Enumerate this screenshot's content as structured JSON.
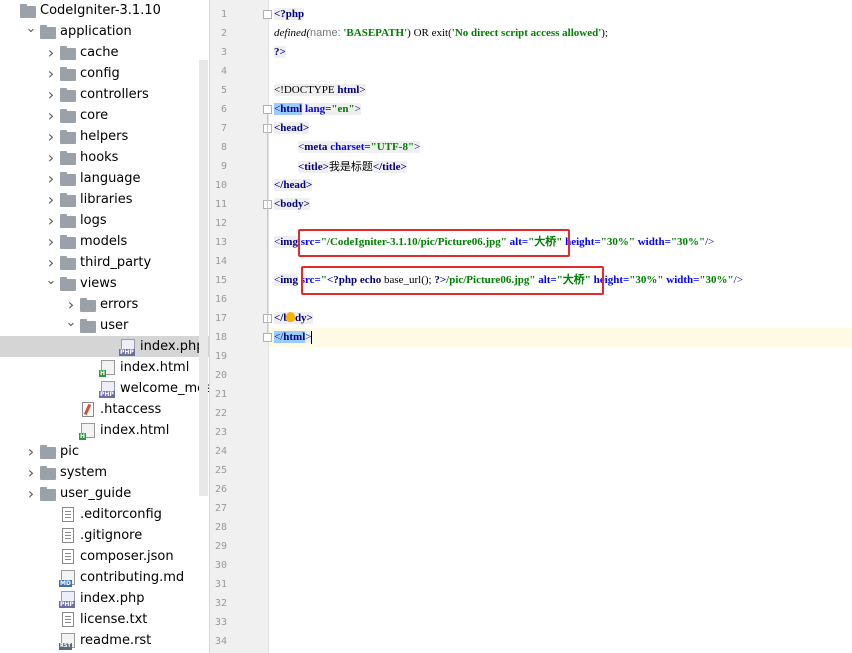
{
  "project_tree": {
    "items": [
      {
        "label": "CodeIgniter-3.1.10",
        "icon": "folder-icon",
        "depth": 0,
        "arrow": "none",
        "selected": false
      },
      {
        "label": "application",
        "icon": "folder-icon",
        "depth": 1,
        "arrow": "down",
        "selected": false
      },
      {
        "label": "cache",
        "icon": "folder-icon",
        "depth": 2,
        "arrow": "right",
        "selected": false
      },
      {
        "label": "config",
        "icon": "folder-icon",
        "depth": 2,
        "arrow": "right",
        "selected": false
      },
      {
        "label": "controllers",
        "icon": "folder-icon",
        "depth": 2,
        "arrow": "right",
        "selected": false
      },
      {
        "label": "core",
        "icon": "folder-icon",
        "depth": 2,
        "arrow": "right",
        "selected": false
      },
      {
        "label": "helpers",
        "icon": "folder-icon",
        "depth": 2,
        "arrow": "right",
        "selected": false
      },
      {
        "label": "hooks",
        "icon": "folder-icon",
        "depth": 2,
        "arrow": "right",
        "selected": false
      },
      {
        "label": "language",
        "icon": "folder-icon",
        "depth": 2,
        "arrow": "right",
        "selected": false
      },
      {
        "label": "libraries",
        "icon": "folder-icon",
        "depth": 2,
        "arrow": "right",
        "selected": false
      },
      {
        "label": "logs",
        "icon": "folder-icon",
        "depth": 2,
        "arrow": "right",
        "selected": false
      },
      {
        "label": "models",
        "icon": "folder-icon",
        "depth": 2,
        "arrow": "right",
        "selected": false
      },
      {
        "label": "third_party",
        "icon": "folder-icon",
        "depth": 2,
        "arrow": "right",
        "selected": false
      },
      {
        "label": "views",
        "icon": "folder-icon",
        "depth": 2,
        "arrow": "down",
        "selected": false
      },
      {
        "label": "errors",
        "icon": "folder-icon",
        "depth": 3,
        "arrow": "right",
        "selected": false
      },
      {
        "label": "user",
        "icon": "folder-icon",
        "depth": 3,
        "arrow": "down",
        "selected": false
      },
      {
        "label": "index.php",
        "icon": "php-icon",
        "depth": 5,
        "arrow": "none",
        "selected": true
      },
      {
        "label": "index.html",
        "icon": "html-icon",
        "depth": 4,
        "arrow": "none",
        "selected": false
      },
      {
        "label": "welcome_message.ph",
        "icon": "php-icon",
        "depth": 4,
        "arrow": "none",
        "selected": false
      },
      {
        "label": ".htaccess",
        "icon": "htaccess-icon",
        "depth": 3,
        "arrow": "none",
        "selected": false
      },
      {
        "label": "index.html",
        "icon": "html-icon",
        "depth": 3,
        "arrow": "none",
        "selected": false
      },
      {
        "label": "pic",
        "icon": "folder-icon",
        "depth": 1,
        "arrow": "right",
        "selected": false
      },
      {
        "label": "system",
        "icon": "folder-icon",
        "depth": 1,
        "arrow": "right",
        "selected": false
      },
      {
        "label": "user_guide",
        "icon": "folder-icon",
        "depth": 1,
        "arrow": "right",
        "selected": false
      },
      {
        "label": ".editorconfig",
        "icon": "file-icon",
        "depth": 2,
        "arrow": "none",
        "selected": false
      },
      {
        "label": ".gitignore",
        "icon": "file-icon",
        "depth": 2,
        "arrow": "none",
        "selected": false
      },
      {
        "label": "composer.json",
        "icon": "file-icon",
        "depth": 2,
        "arrow": "none",
        "selected": false
      },
      {
        "label": "contributing.md",
        "icon": "md-icon",
        "depth": 2,
        "arrow": "none",
        "selected": false
      },
      {
        "label": "index.php",
        "icon": "php-icon",
        "depth": 2,
        "arrow": "none",
        "selected": false
      },
      {
        "label": "license.txt",
        "icon": "file-icon",
        "depth": 2,
        "arrow": "none",
        "selected": false
      },
      {
        "label": "readme.rst",
        "icon": "rst-icon",
        "depth": 2,
        "arrow": "none",
        "selected": false
      }
    ]
  },
  "editor": {
    "line_numbers": [
      "1",
      "2",
      "3",
      "4",
      "5",
      "6",
      "7",
      "8",
      "9",
      "10",
      "11",
      "12",
      "13",
      "14",
      "15",
      "16",
      "17",
      "18",
      "19",
      "20",
      "21",
      "22",
      "23",
      "24",
      "25",
      "26",
      "27",
      "28",
      "29",
      "30",
      "31",
      "32",
      "33",
      "34"
    ],
    "code": {
      "l1_open": "<?php",
      "l2_fn": "defined(",
      "l2_hint": "name:",
      "l2_const": "'BASEPATH'",
      "l2_or": ") OR exit(",
      "l2_msg": "'No direct script access allowed'",
      "l2_end": ");",
      "l3_close": "?>",
      "l5_doctype_open": "<!DOCTYPE ",
      "l5_doctype_name": "html",
      "l5_doctype_close": ">",
      "l6_lt": "<",
      "l6_tag": "html",
      "l6_attr": " lang=",
      "l6_val": "\"en\"",
      "l6_gt": ">",
      "l7_text": "<head>",
      "l8_lt": "<",
      "l8_tag": "meta",
      "l8_attr": " charset=",
      "l8_val": "\"UTF-8\"",
      "l8_gt": ">",
      "l9_open": "<title>",
      "l9_text": "我是标题",
      "l9_close": "</title>",
      "l10_text": "</head>",
      "l11_text": "<body>",
      "l13_lt": "<",
      "l13_tag": "img",
      "l13_src_attr": " src=",
      "l13_src_val": "\"/CodeIgniter-3.1.10/pic/Picture06.jpg\"",
      "l13_alt_attr": " alt=",
      "l13_alt_val": "\"大桥\"",
      "l13_h_attr": " height=",
      "l13_h_val": "\"30%\"",
      "l13_w_attr": " width=",
      "l13_w_val": "\"30%\"",
      "l13_gt": "/>",
      "l15_lt": "<",
      "l15_tag": "img",
      "l15_src_attr": " src=",
      "l15_src_q": "\"",
      "l15_php_open": "<?php",
      "l15_echo": " echo ",
      "l15_fn": "base_url(); ",
      "l15_php_close": "?>",
      "l15_path": "/pic/Picture06.jpg\"",
      "l15_alt_attr": " alt=",
      "l15_alt_val": "\"大桥\"",
      "l15_h_attr": " height=",
      "l15_h_val": "\"30%\"",
      "l15_w_attr": " width=",
      "l15_w_val": "\"30%\"",
      "l15_gt": "/>",
      "l17_text": "</body>",
      "l18_open": "</",
      "l18_tag": "html",
      "l18_gt": ">"
    }
  }
}
